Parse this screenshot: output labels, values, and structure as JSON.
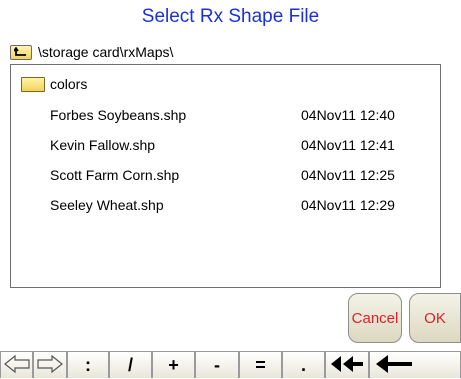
{
  "dialog": {
    "title": "Select Rx Shape File"
  },
  "path": {
    "icon": "folder-up-icon",
    "text": "\\storage card\\rxMaps\\"
  },
  "file_list": {
    "folders": [
      {
        "name": "colors",
        "icon": "folder-icon"
      }
    ],
    "files": [
      {
        "name": "Forbes Soybeans.shp",
        "date": "04Nov11 12:40"
      },
      {
        "name": "Kevin Fallow.shp",
        "date": "04Nov11 12:41"
      },
      {
        "name": "Scott Farm Corn.shp",
        "date": "04Nov11 12:25"
      },
      {
        "name": "Seeley Wheat.shp",
        "date": "04Nov11 12:29"
      }
    ]
  },
  "buttons": {
    "cancel": "Cancel",
    "ok": "OK"
  },
  "keyboard": {
    "keys": [
      {
        "label": "",
        "icon": "arrow-left-outline-icon"
      },
      {
        "label": "",
        "icon": "arrow-right-outline-icon"
      },
      {
        "label": ":"
      },
      {
        "label": "/"
      },
      {
        "label": "+"
      },
      {
        "label": "-"
      },
      {
        "label": "="
      },
      {
        "label": "."
      },
      {
        "label": "",
        "icon": "double-arrow-left-icon"
      },
      {
        "label": "",
        "icon": "backspace-arrow-icon"
      }
    ]
  },
  "colors": {
    "title": "#1a32d8",
    "button_text": "#e0202a"
  }
}
